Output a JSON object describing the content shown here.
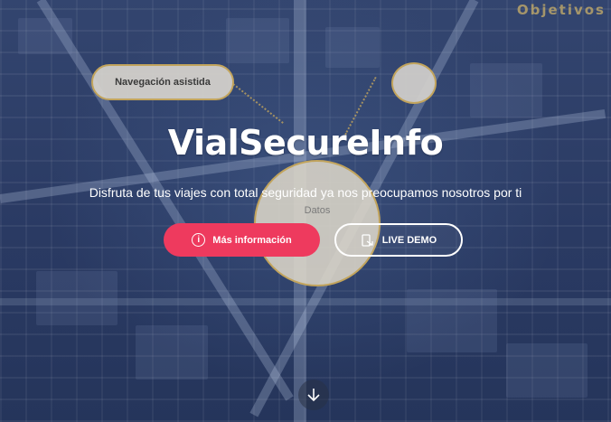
{
  "map": {
    "corner_label": "Objetivos",
    "nav_pill": "Navegación asistida",
    "center_circle_text": "Datos"
  },
  "hero": {
    "title": "VialSecureInfo",
    "subtitle": "Disfruta de tus viajes con total seguridad ya nos preocupamos nosotros por ti"
  },
  "buttons": {
    "info_label": "Más información",
    "info_icon": "info-icon",
    "demo_label": "LIVE DEMO",
    "demo_icon": "demo-icon"
  },
  "scroll": {
    "icon": "arrow-down-icon"
  },
  "colors": {
    "accent": "#ee3a5e",
    "gold": "#c2a45c",
    "background": "#2d3e66"
  }
}
